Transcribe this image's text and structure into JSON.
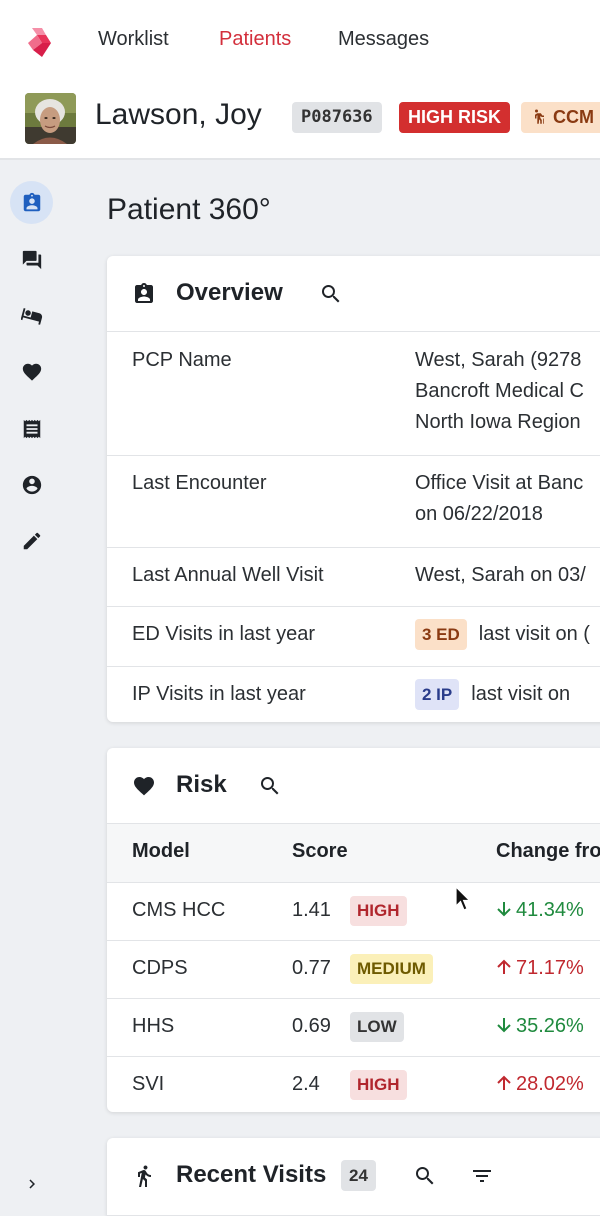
{
  "nav": {
    "items": [
      {
        "label": "Worklist",
        "active": false
      },
      {
        "label": "Patients",
        "active": true
      },
      {
        "label": "Messages",
        "active": false
      }
    ]
  },
  "patient": {
    "name": "Lawson, Joy",
    "id": "P087636",
    "risk_badge": "HIGH RISK",
    "program_badge": "CCM"
  },
  "sidebar": {
    "icons": [
      "patient-id-icon",
      "chat-icon",
      "hospital-bed-icon",
      "heart-icon",
      "receipt-icon",
      "account-circle-icon",
      "pencil-icon"
    ],
    "expand_icon": "chevron-right-icon"
  },
  "page": {
    "title": "Patient 360°"
  },
  "overview": {
    "title": "Overview",
    "rows": [
      {
        "label": "PCP Name",
        "lines": [
          "West, Sarah (9278",
          "Bancroft Medical C",
          "North Iowa Region"
        ]
      },
      {
        "label": "Last Encounter",
        "lines": [
          "Office Visit at Banc",
          "on 06/22/2018"
        ]
      },
      {
        "label": "Last Annual Well Visit",
        "lines": [
          "West, Sarah on 03/"
        ]
      },
      {
        "label": "ED Visits in last year",
        "chip": "3 ED",
        "text": "last visit on ("
      },
      {
        "label": "IP Visits in last year",
        "chip": "2 IP",
        "text": "last visit on"
      }
    ]
  },
  "risk": {
    "title": "Risk",
    "columns": [
      "Model",
      "Score",
      "Change fro"
    ],
    "rows": [
      {
        "model": "CMS HCC",
        "score": "1.41",
        "level": "HIGH",
        "direction": "down",
        "change": "41.34%"
      },
      {
        "model": "CDPS",
        "score": "0.77",
        "level": "MEDIUM",
        "direction": "up",
        "change": "71.17%"
      },
      {
        "model": "HHS",
        "score": "0.69",
        "level": "LOW",
        "direction": "down",
        "change": "35.26%"
      },
      {
        "model": "SVI",
        "score": "2.4",
        "level": "HIGH",
        "direction": "up",
        "change": "28.02%"
      }
    ]
  },
  "recent_visits": {
    "title": "Recent Visits",
    "count": "24"
  },
  "colors": {
    "accent_red": "#d32f3c",
    "active_sidebar_bg": "#d7e3f5",
    "increase_red": "#c0282f",
    "decrease_green": "#1f8a3e"
  }
}
